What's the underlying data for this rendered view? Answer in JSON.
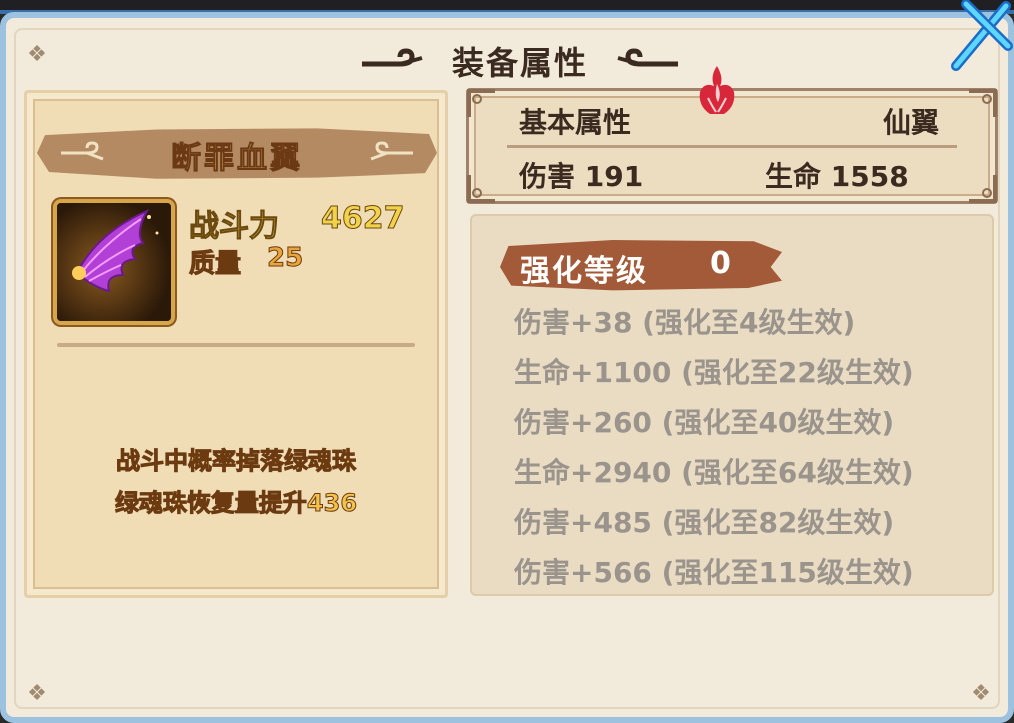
{
  "window": {
    "title": "装备属性"
  },
  "item": {
    "name": "断罪血翼",
    "power_label": "战斗力",
    "power_value": "4627",
    "quality_label": "质量",
    "quality_value": "25",
    "icon": "purple-wing-icon",
    "effects": [
      "战斗中概率掉落绿魂珠",
      "绿魂珠恢复量提升436"
    ]
  },
  "basic": {
    "heading": "基本属性",
    "type": "仙翼",
    "stats": [
      "伤害 191",
      "生命 1558"
    ]
  },
  "enhance": {
    "title": "强化等级",
    "level": "0",
    "rows": [
      "伤害+38 (强化至4级生效)",
      "生命+1100 (强化至22级生效)",
      "伤害+260 (强化至40级生效)",
      "生命+2940 (强化至64级生效)",
      "伤害+485 (强化至82级生效)",
      "伤害+566 (强化至115级生效)"
    ]
  },
  "colors": {
    "panel_bg": "#f2eadb",
    "frame_blue": "#9cc2e0",
    "banner_brown": "#b48a63",
    "enhance_banner": "#a35a38",
    "gold_text": "#f2d24a",
    "inactive_text": "#9a948d"
  }
}
